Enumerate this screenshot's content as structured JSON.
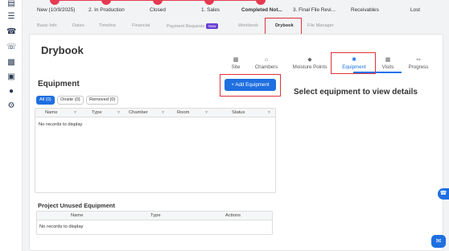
{
  "sidebar": {
    "icons": [
      "layers-icon",
      "map-icon",
      "headset-icon",
      "phone-icon",
      "contacts-icon",
      "truck-icon",
      "team-icon",
      "gear-icon"
    ]
  },
  "stages": [
    {
      "label": "New (10/9/2025)",
      "done": true
    },
    {
      "label": "2. In Production",
      "done": true
    },
    {
      "label": "Closed",
      "done": true
    },
    {
      "label": "1. Sales",
      "done": true
    },
    {
      "label": "Completed Not...",
      "done": true,
      "current": true
    },
    {
      "label": "3. Final File Revi...",
      "done": false
    },
    {
      "label": "Receivables",
      "done": false
    },
    {
      "label": "Lost",
      "done": false
    }
  ],
  "tabs": [
    {
      "label": "Basic Info"
    },
    {
      "label": "Dates"
    },
    {
      "label": "Timeline"
    },
    {
      "label": "Financial"
    },
    {
      "label": "Payment Requests",
      "badge": "New"
    },
    {
      "label": "Workbook"
    },
    {
      "label": "Drybook",
      "active": true
    },
    {
      "label": "File Manager"
    }
  ],
  "page": {
    "title": "Drybook"
  },
  "nav": [
    {
      "label": "Site",
      "icon": "bar-chart-icon"
    },
    {
      "label": "Chambers",
      "icon": "chamber-icon"
    },
    {
      "label": "Moisture Points",
      "icon": "moisture-icon"
    },
    {
      "label": "Equipment",
      "icon": "fan-icon",
      "active": true
    },
    {
      "label": "Visits",
      "icon": "calendar-icon"
    },
    {
      "label": "Progress",
      "icon": "line-chart-icon"
    }
  ],
  "equipment": {
    "title": "Equipment",
    "add_label": "+ Add Equipment",
    "filters": [
      {
        "label": "All (0)",
        "active": true
      },
      {
        "label": "Onsite (0)"
      },
      {
        "label": "Removed (0)"
      }
    ],
    "columns": [
      "Name",
      "Type",
      "Chamber",
      "Room",
      "Status"
    ],
    "empty": "No records to display"
  },
  "detail": {
    "message": "Select equipment to view details"
  },
  "unused": {
    "title": "Project Unused Equipment",
    "columns": [
      "Name",
      "Type",
      "Actions"
    ],
    "empty": "No records to display"
  }
}
